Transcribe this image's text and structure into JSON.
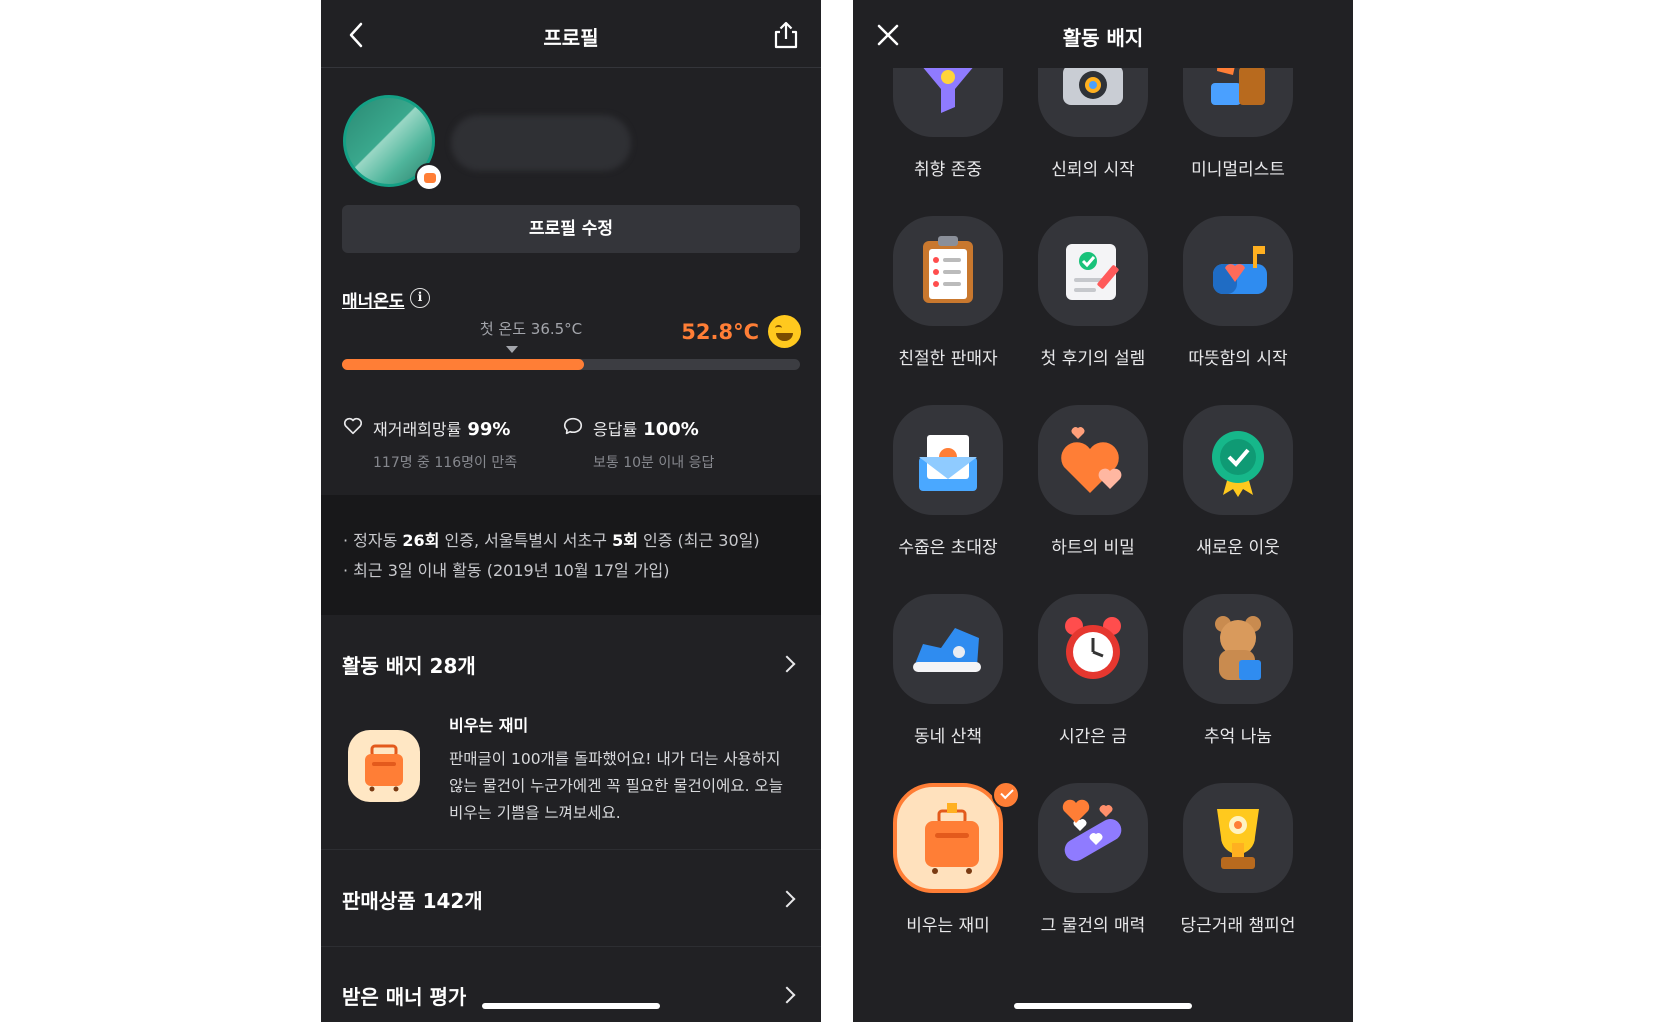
{
  "left": {
    "header": {
      "title": "프로필"
    },
    "profile": {
      "edit_label": "프로필 수정"
    },
    "manner": {
      "label": "매너온도",
      "first_temp": "첫 온도 36.5°C",
      "value_text": "52.8°C",
      "progress": 0.528
    },
    "stats": [
      {
        "label": "재거래희망률",
        "value": "99%",
        "sub": "117명 중 116명이 만족",
        "icon": "heart-outline-icon"
      },
      {
        "label": "응답률",
        "value": "100%",
        "sub": "보통 10분 이내 응답",
        "icon": "chat-bubble-icon"
      }
    ],
    "auth": {
      "line1_a": "· 정자동 ",
      "line1_b": "26회",
      "line1_c": " 인증, 서울특별시 서초구 ",
      "line1_d": "5회",
      "line1_e": " 인증 (최근 30일)",
      "line2": "· 최근 3일 이내 활동 (2019년 10월 17일 가입)"
    },
    "badges_section": {
      "title": "활동 배지 28개"
    },
    "featured_badge": {
      "name": "비우는 재미",
      "desc": "판매글이 100개를 돌파했어요! 내가 더는 사용하지 않는 물건이 누군가에겐 꼭 필요한 물건이에요. 오늘 비우는 기쁨을 느껴보세요."
    },
    "sales_section": {
      "title": "판매상품 142개"
    },
    "reviews_section": {
      "title": "받은 매너 평가"
    }
  },
  "right": {
    "header": {
      "title": "활동 배지"
    },
    "badges": [
      {
        "label": "취향 존중",
        "icon": "funnel-icon"
      },
      {
        "label": "신뢰의 시작",
        "icon": "camera-icon"
      },
      {
        "label": "미니멀리스트",
        "icon": "boxes-icon"
      },
      {
        "label": "친절한 판매자",
        "icon": "clipboard-icon"
      },
      {
        "label": "첫 후기의 설렘",
        "icon": "review-note-icon"
      },
      {
        "label": "따뜻함의 시작",
        "icon": "mailbox-icon"
      },
      {
        "label": "수줍은 초대장",
        "icon": "invitation-icon"
      },
      {
        "label": "하트의 비밀",
        "icon": "hearts-icon"
      },
      {
        "label": "새로운 이웃",
        "icon": "award-badge-icon"
      },
      {
        "label": "동네 산책",
        "icon": "sneaker-icon"
      },
      {
        "label": "시간은 금",
        "icon": "alarm-clock-icon"
      },
      {
        "label": "추억 나눔",
        "icon": "teddy-bear-icon"
      },
      {
        "label": "비우는 재미",
        "icon": "suitcase-icon",
        "selected": true
      },
      {
        "label": "그 물건의 매력",
        "icon": "bandage-hearts-icon"
      },
      {
        "label": "당근거래 챔피언",
        "icon": "trophy-icon"
      }
    ]
  },
  "colors": {
    "accent": "#ff7e36",
    "background": "#212124",
    "surface": "#34353a"
  }
}
